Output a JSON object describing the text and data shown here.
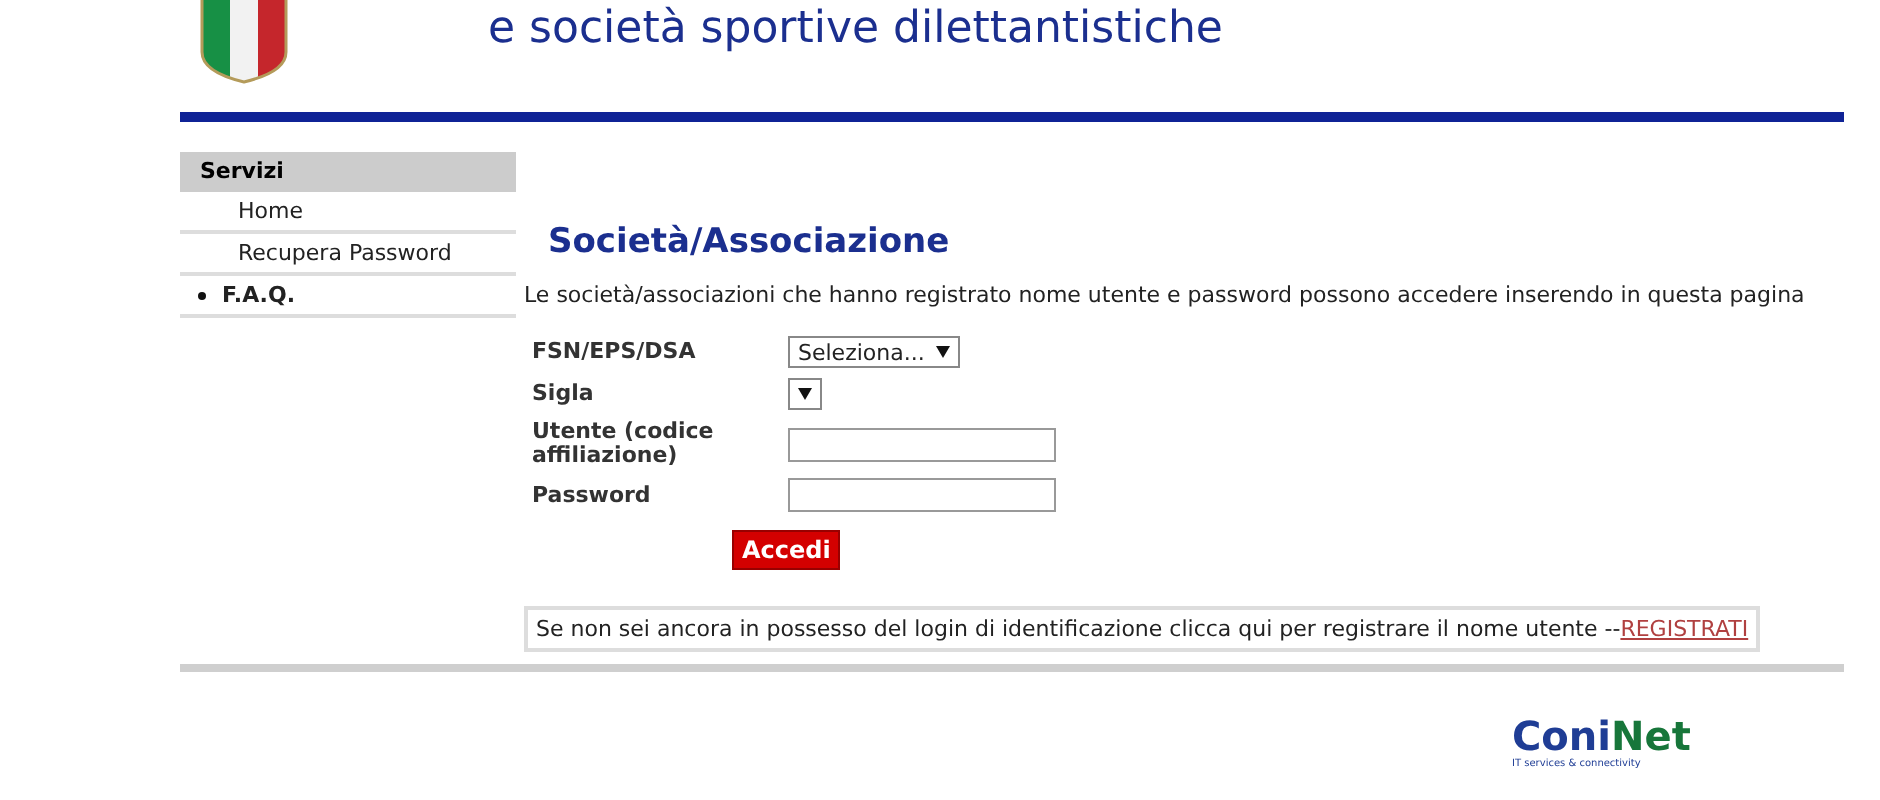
{
  "header": {
    "title": "e società sportive dilettantistiche"
  },
  "sidebar": {
    "heading": "Servizi",
    "items": [
      {
        "label": "Home",
        "selected": false
      },
      {
        "label": "Recupera Password",
        "selected": false
      },
      {
        "label": "F.A.Q.",
        "selected": true
      }
    ]
  },
  "main": {
    "title": "Società/Associazione",
    "intro": "Le società/associazioni che hanno registrato nome utente e password possono accedere inserendo in questa pagina",
    "fields": [
      {
        "kind": "select",
        "label": "FSN/EPS/DSA",
        "value": "Seleziona..."
      },
      {
        "kind": "select",
        "label": "Sigla"
      },
      {
        "kind": "text",
        "label": "Utente (codice affiliazione)"
      },
      {
        "kind": "text",
        "label": "Password"
      }
    ],
    "submit": "Accedi",
    "register_note": "Se non sei ancora in possesso del login di identificazione clicca qui per registrare il nome utente --",
    "register_link": "REGISTRATI"
  },
  "footer": {
    "logo": [
      {
        "text": "Coni",
        "color": "#1f3d95"
      },
      {
        "text": "Net",
        "color": "#17763a"
      }
    ],
    "tagline": "IT services & connectivity"
  }
}
